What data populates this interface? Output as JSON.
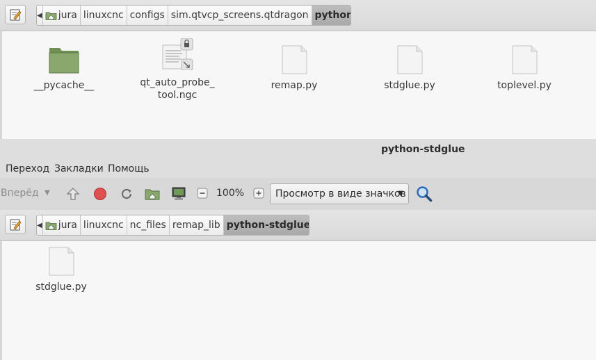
{
  "top_window": {
    "breadcrumbs": [
      "jura",
      "linuxcnc",
      "configs",
      "sim.qtvcp_screens.qtdragon",
      "python"
    ],
    "files": [
      {
        "name_lines": [
          "__pycache__"
        ],
        "icon": "folder-icon"
      },
      {
        "name_lines": [
          "qt_auto_probe_",
          "tool.ngc"
        ],
        "icon": "text-file-icon"
      },
      {
        "name_lines": [
          "remap.py"
        ],
        "icon": "file-icon"
      },
      {
        "name_lines": [
          "stdglue.py"
        ],
        "icon": "file-icon"
      },
      {
        "name_lines": [
          "toplevel.py"
        ],
        "icon": "file-icon"
      }
    ]
  },
  "bottom_window": {
    "title": "python-stdglue",
    "menu": [
      "Переход",
      "Закладки",
      "Помощь"
    ],
    "toolbar": {
      "forward_label": "Вперёд",
      "zoom": "100%",
      "view_mode": "Просмотр в виде значков"
    },
    "breadcrumbs": [
      "jura",
      "linuxcnc",
      "nc_files",
      "remap_lib",
      "python-stdglue"
    ],
    "files": [
      {
        "name": "stdglue.py",
        "icon": "file-icon"
      }
    ]
  },
  "colors": {
    "folder_green": "#8aa86e",
    "stop_red": "#e05050",
    "search_blue": "#2a6ab8"
  }
}
